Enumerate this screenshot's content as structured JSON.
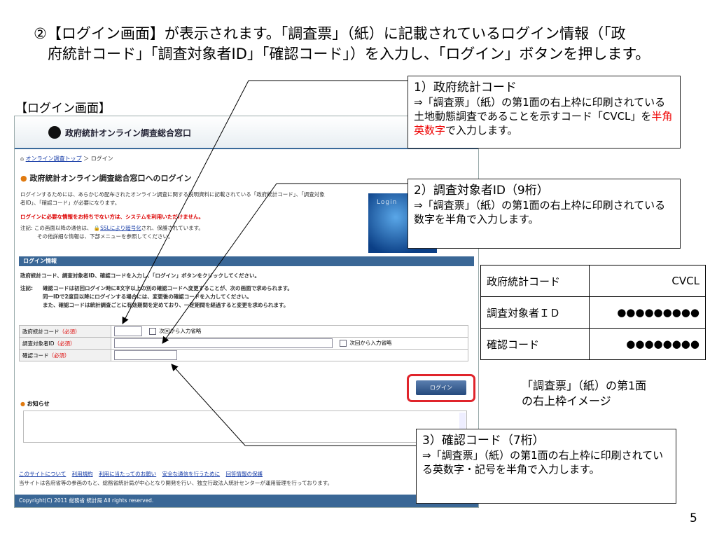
{
  "heading": {
    "line1": "②【ログイン画面】が表示されます。「調査票」（紙）に記載されているログイン情報（「政",
    "line2": "府統計コード」「調査対象者ID」「確認コード」）を入力し、「ログイン」ボタンを押します。"
  },
  "screen_label": "【ログイン画面】",
  "screen": {
    "site_name": "政府統計オンライン調査総合窓口",
    "breadcrumb": {
      "home": "オンライン調査トップ",
      "sep": "＞",
      "current": "ログイン"
    },
    "page_title": "政府統計オンライン調査総合窓口へのログイン",
    "intro1": "ログインするためには、あらかじめ配布されたオンライン調査に関する説明資料に記載されている「政府統計コード」、「調査対象",
    "intro2": "者ID」、「確認コード」が必要になります。",
    "warning": "ログインに必要な情報をお持ちでない方は、システムを利用いただけません。",
    "note_label": "注記:",
    "note1_pre": "この画面以降の通信は、",
    "note1_link": "SSLにより暗号化",
    "note1_post": "され、保護されています。",
    "note2": "その他詳細な情報は、下部メニューを参照してください。",
    "login_image_text": "Login",
    "section_title": "ログイン情報",
    "instruction": "政府統計コード、調査対象者ID、確認コードを入力し、「ログイン」ボタンをクリックしてください。",
    "note_b1": "確認コードは初回ログイン時に8文字以上の別の確認コードへ変更することが、次の画面で求められます。",
    "note_b2": "同一IDで2度目以降にログインする場合には、変更後の確認コードを入力してください。",
    "note_b3": "また、確認コードは統計調査ごとに有効期間を定めており、一定期間を経過すると変更を求められます。",
    "fields": [
      {
        "label": "政府統計コード",
        "required": "（必須）",
        "remember": "次回から入力省略"
      },
      {
        "label": "調査対象者ID",
        "required": "（必須）",
        "remember": "次回から入力省略"
      },
      {
        "label": "確認コード",
        "required": "（必須）"
      }
    ],
    "login_button": "ログイン",
    "notice_title": "お知らせ",
    "footer_links": [
      "このサイトについて",
      "利用規約",
      "利用に当たってのお願い",
      "安全な通信を行うために",
      "回答情報の保護"
    ],
    "footer_note": "当サイトは各府省等の参画のもと、総務省統計局が中心となり開発を行い、独立行政法人統計センターが運用管理を行っております。",
    "copyright": "Copyright(C) 2011 総務省 統計局 All rights reserved."
  },
  "callouts": {
    "c1": {
      "title": "1）政府統計コード",
      "body_pre": "⇒「調査票」（紙）の第1面の右上枠に印刷されている土地動態調査であることを示すコード「CVCL」を",
      "body_highlight": "半角英数字",
      "body_post": "で入力します。"
    },
    "c2": {
      "title": "2）調査対象者ID（9桁）",
      "body": "⇒「調査票」（紙）の第1面の右上枠に印刷されている数字を半角で入力します。"
    },
    "c3": {
      "title": "3）確認コード（7桁）",
      "body": "⇒「調査票」（紙）の第1面の右上枠に印刷されている英数字・記号を半角で入力します。"
    }
  },
  "card": {
    "rows": [
      {
        "key": "政府統計コード",
        "value": "CVCL"
      },
      {
        "key": "調査対象者ＩＤ",
        "value": "●●●●●●●●●"
      },
      {
        "key": "確認コード",
        "value": "●●●●●●●●"
      }
    ],
    "caption1": "「調査票」（紙）の第1面",
    "caption2": "の右上枠イメージ"
  },
  "page_number": "5"
}
